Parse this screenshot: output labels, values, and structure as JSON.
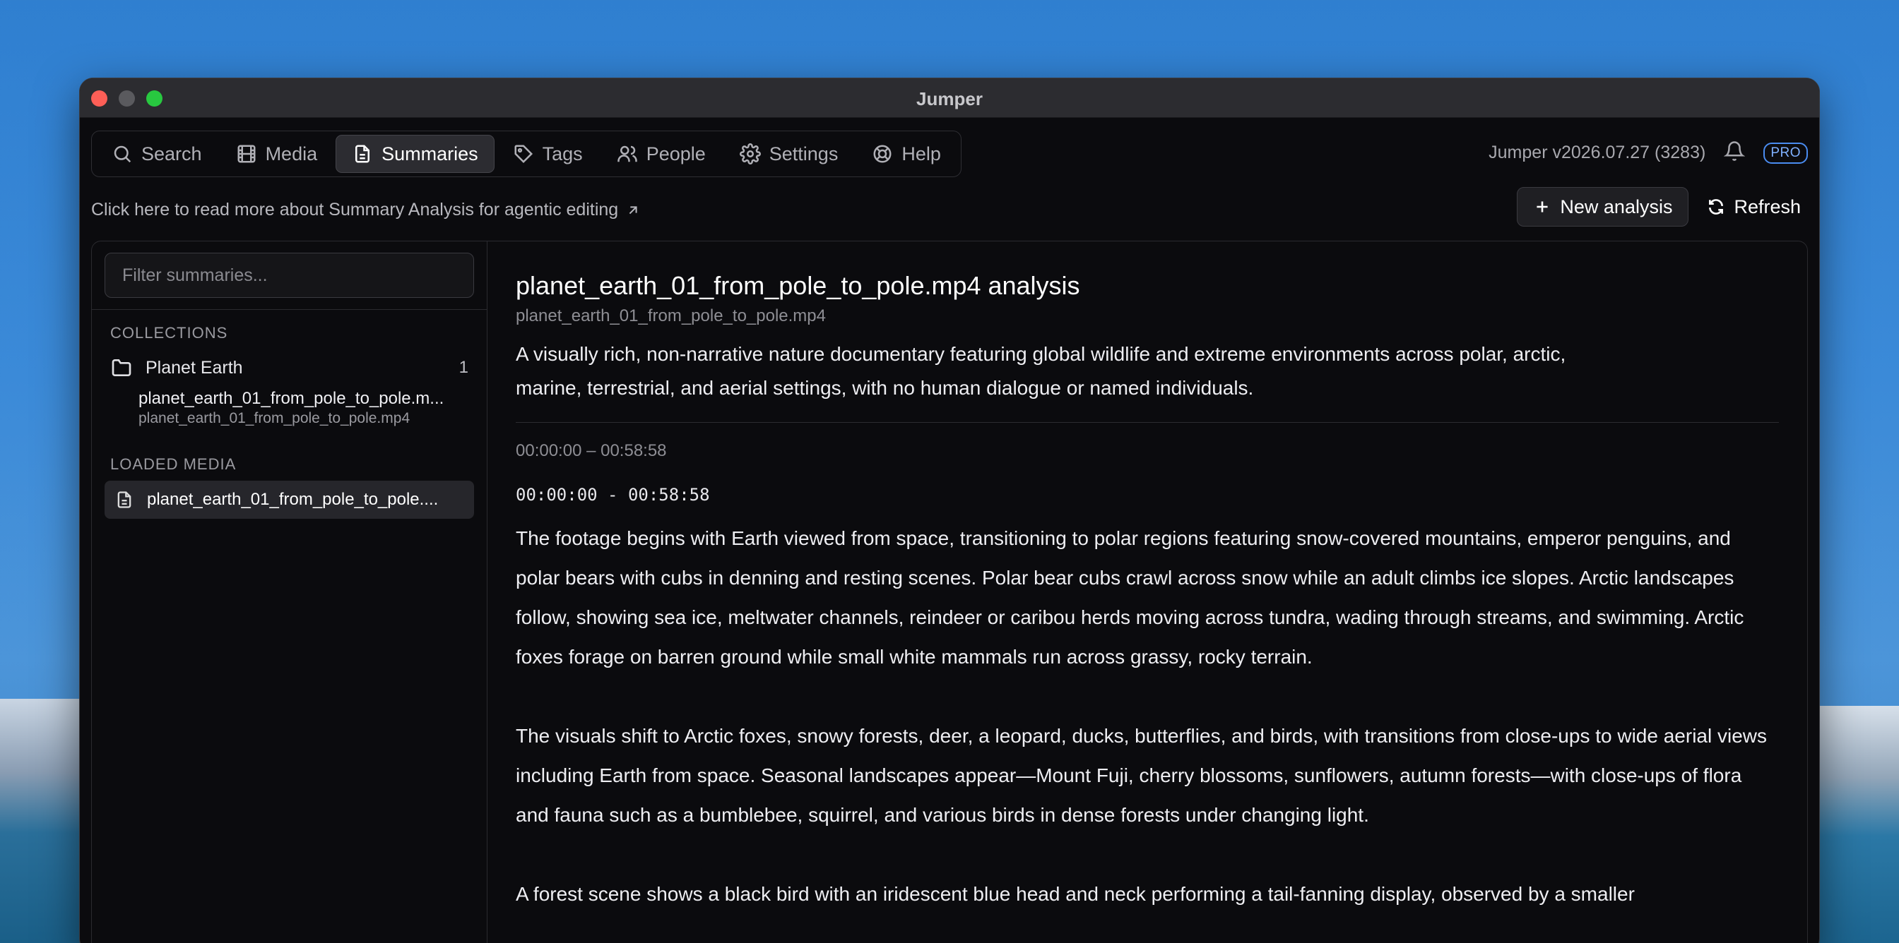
{
  "window": {
    "title": "Jumper"
  },
  "nav": {
    "tabs": [
      {
        "label": "Search",
        "icon": "search-icon"
      },
      {
        "label": "Media",
        "icon": "film-icon"
      },
      {
        "label": "Summaries",
        "icon": "document-icon",
        "active": true
      },
      {
        "label": "Tags",
        "icon": "tag-icon"
      },
      {
        "label": "People",
        "icon": "people-icon"
      },
      {
        "label": "Settings",
        "icon": "gear-icon"
      },
      {
        "label": "Help",
        "icon": "lifebuoy-icon"
      }
    ]
  },
  "header": {
    "version": "Jumper v2026.07.27 (3283)",
    "badge": "PRO"
  },
  "infobar": {
    "link_text": "Click here to read more about Summary Analysis for agentic editing",
    "new_analysis": "New analysis",
    "refresh": "Refresh"
  },
  "sidebar": {
    "filter_placeholder": "Filter summaries...",
    "collections_label": "COLLECTIONS",
    "collection": {
      "name": "Planet Earth",
      "count": "1",
      "item_name": "planet_earth_01_from_pole_to_pole.m...",
      "item_sub": "planet_earth_01_from_pole_to_pole.mp4"
    },
    "loaded_label": "LOADED MEDIA",
    "loaded_item": "planet_earth_01_from_pole_to_pole...."
  },
  "main": {
    "title": "planet_earth_01_from_pole_to_pole.mp4 analysis",
    "filename": "planet_earth_01_from_pole_to_pole.mp4",
    "description": "A visually rich, non-narrative nature documentary featuring global wildlife and extreme environments across polar, arctic, marine, terrestrial, and aerial settings, with no human dialogue or named individuals.",
    "range": "00:00:00 – 00:58:58",
    "range_mono": "00:00:00 - 00:58:58",
    "paragraphs": [
      "The footage begins with Earth viewed from space, transitioning to polar regions featuring snow-covered mountains, emperor penguins, and polar bears with cubs in denning and resting scenes. Polar bear cubs crawl across snow while an adult climbs ice slopes. Arctic landscapes follow, showing sea ice, meltwater channels, reindeer or caribou herds moving across tundra, wading through streams, and swimming. Arctic foxes forage on barren ground while small white mammals run across grassy, rocky terrain.",
      "The visuals shift to Arctic foxes, snowy forests, deer, a leopard, ducks, butterflies, and birds, with transitions from close-ups to wide aerial views including Earth from space. Seasonal landscapes appear—Mount Fuji, cherry blossoms, sunflowers, autumn forests—with close-ups of flora and fauna such as a bumblebee, squirrel, and various birds in dense forests under changing light.",
      "A forest scene shows a black bird with an iridescent blue head and neck performing a tail-fanning display, observed by a smaller"
    ]
  }
}
